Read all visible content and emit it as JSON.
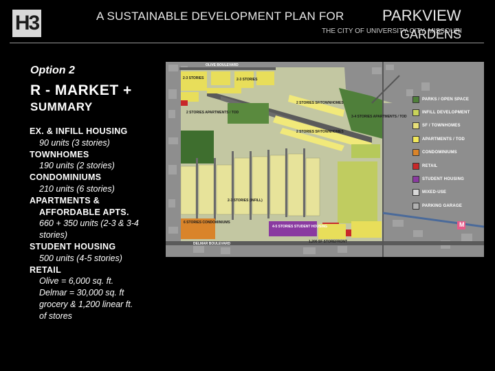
{
  "header": {
    "logo": "H3",
    "title": "A SUSTAINABLE DEVELOPMENT PLAN FOR",
    "title_highlight_1": "PARKVIEW",
    "title_highlight_2": "GARDENS",
    "subtitle": "THE CITY OF UNIVERSITY CITY, MISSOURI"
  },
  "option_label": "Option 2",
  "heading": "R - MARKET +",
  "summary_label": "SUMMARY",
  "items": [
    {
      "category": "EX. & INFILL HOUSING",
      "detail": "90 units (3 stories)"
    },
    {
      "category": "TOWNHOMES",
      "detail": "190 units (2 stories)"
    },
    {
      "category": "CONDOMINIUMS",
      "detail": "210 units (6 stories)"
    },
    {
      "category": "APARTMENTS &",
      "category_2": "AFFORDABLE APTS.",
      "detail": "660 + 350 units (2-3 & 3-4 stories)"
    },
    {
      "category": "STUDENT HOUSING",
      "detail": "500 units (4-5 stories)"
    },
    {
      "category": "RETAIL",
      "detail": "Olive = 6,000 sq. ft.",
      "detail_2": "Delmar = 30,000 sq. ft",
      "detail_3": "grocery & 1,200 linear ft.",
      "detail_4": "of stores"
    }
  ],
  "legend": [
    {
      "label": "PARKS / OPEN SPACE",
      "color": "#4f7f3a"
    },
    {
      "label": "INFILL DEVELOPMENT",
      "color": "#c9d45a"
    },
    {
      "label": "SF / TOWNHOMES",
      "color": "#e8e07a"
    },
    {
      "label": "APARTMENTS / TOD",
      "color": "#f2e85a"
    },
    {
      "label": "CONDOMINIUMS",
      "color": "#d9842a"
    },
    {
      "label": "RETAIL",
      "color": "#c8282a"
    },
    {
      "label": "STUDENT HOUSING",
      "color": "#8a3aa0"
    },
    {
      "label": "MIXED-USE",
      "color": "#d8d8d8"
    },
    {
      "label": "PARKING GARAGE",
      "color": "#b0b0b0"
    }
  ],
  "map_labels": {
    "olive_blvd": "OLIVE BOULEVARD",
    "delmar_blvd": "DELMAR BOULEVARD",
    "stories_2_3": "2-3 STORIES",
    "stories_2_apts": "2 STORIES APARTMENTS / TOD",
    "stories_2_townhomes": "2 STORIES SF/TOWNHOMES",
    "stories_3_4": "3-4 STORIES APARTMENTS / TOD",
    "infill": "2-3 STORIES (INFILL)",
    "condos": "6 STORIES CONDOMINIUMS",
    "student": "4-5 STORIES STUDENT HOUSING",
    "storefront": "1,200 SF STOREFRONT",
    "metro": "M"
  }
}
